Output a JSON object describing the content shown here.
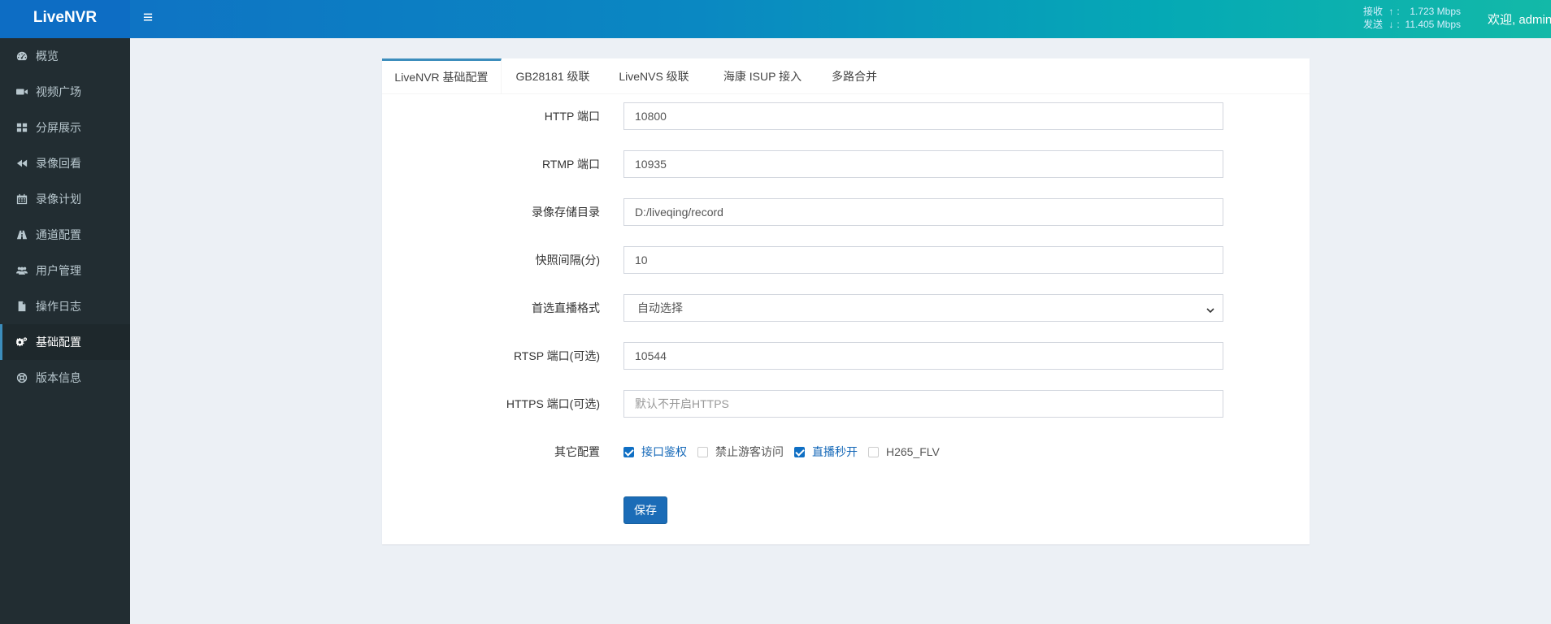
{
  "app": {
    "title": "LiveNVR"
  },
  "header": {
    "menu_icon": "hamburger-icon",
    "receive_label": "接收",
    "receive_value": "1.723 Mbps",
    "send_label": "发送",
    "send_value": "11.405 Mbps",
    "welcome": "欢迎, admin"
  },
  "sidebar": {
    "items": [
      {
        "label": "概览",
        "icon": "dashboard-icon"
      },
      {
        "label": "视频广场",
        "icon": "video-camera-icon"
      },
      {
        "label": "分屏展示",
        "icon": "grid-icon"
      },
      {
        "label": "录像回看",
        "icon": "rewind-icon"
      },
      {
        "label": "录像计划",
        "icon": "calendar-icon"
      },
      {
        "label": "通道配置",
        "icon": "road-icon"
      },
      {
        "label": "用户管理",
        "icon": "users-icon"
      },
      {
        "label": "操作日志",
        "icon": "file-icon"
      },
      {
        "label": "基础配置",
        "icon": "cogs-icon",
        "active": true
      },
      {
        "label": "版本信息",
        "icon": "lifebuoy-icon"
      }
    ]
  },
  "tabs": [
    {
      "label": "LiveNVR 基础配置",
      "active": true
    },
    {
      "label": "GB28181 级联"
    },
    {
      "label": "LiveNVS 级联"
    },
    {
      "label": "海康 ISUP 接入"
    },
    {
      "label": "多路合并"
    }
  ],
  "form": {
    "http_port": {
      "label": "HTTP 端口",
      "value": "10800"
    },
    "rtmp_port": {
      "label": "RTMP 端口",
      "value": "10935"
    },
    "record_dir": {
      "label": "录像存储目录",
      "value": "D:/liveqing/record"
    },
    "snapshot_interval": {
      "label": "快照间隔(分)",
      "value": "10"
    },
    "live_format": {
      "label": "首选直播格式",
      "value": "自动选择"
    },
    "rtsp_port": {
      "label": "RTSP 端口(可选)",
      "value": "10544"
    },
    "https_port": {
      "label": "HTTPS 端口(可选)",
      "value": "",
      "placeholder": "默认不开启HTTPS"
    },
    "other": {
      "label": "其它配置",
      "options": [
        {
          "label": "接口鉴权",
          "checked": true
        },
        {
          "label": "禁止游客访问",
          "checked": false
        },
        {
          "label": "直播秒开",
          "checked": true
        },
        {
          "label": "H265_FLV",
          "checked": false
        }
      ]
    },
    "save_label": "保存"
  },
  "colors": {
    "accent": "#0f6fc4",
    "sidebar_bg": "#222d32",
    "page_bg": "#ecf0f5"
  }
}
